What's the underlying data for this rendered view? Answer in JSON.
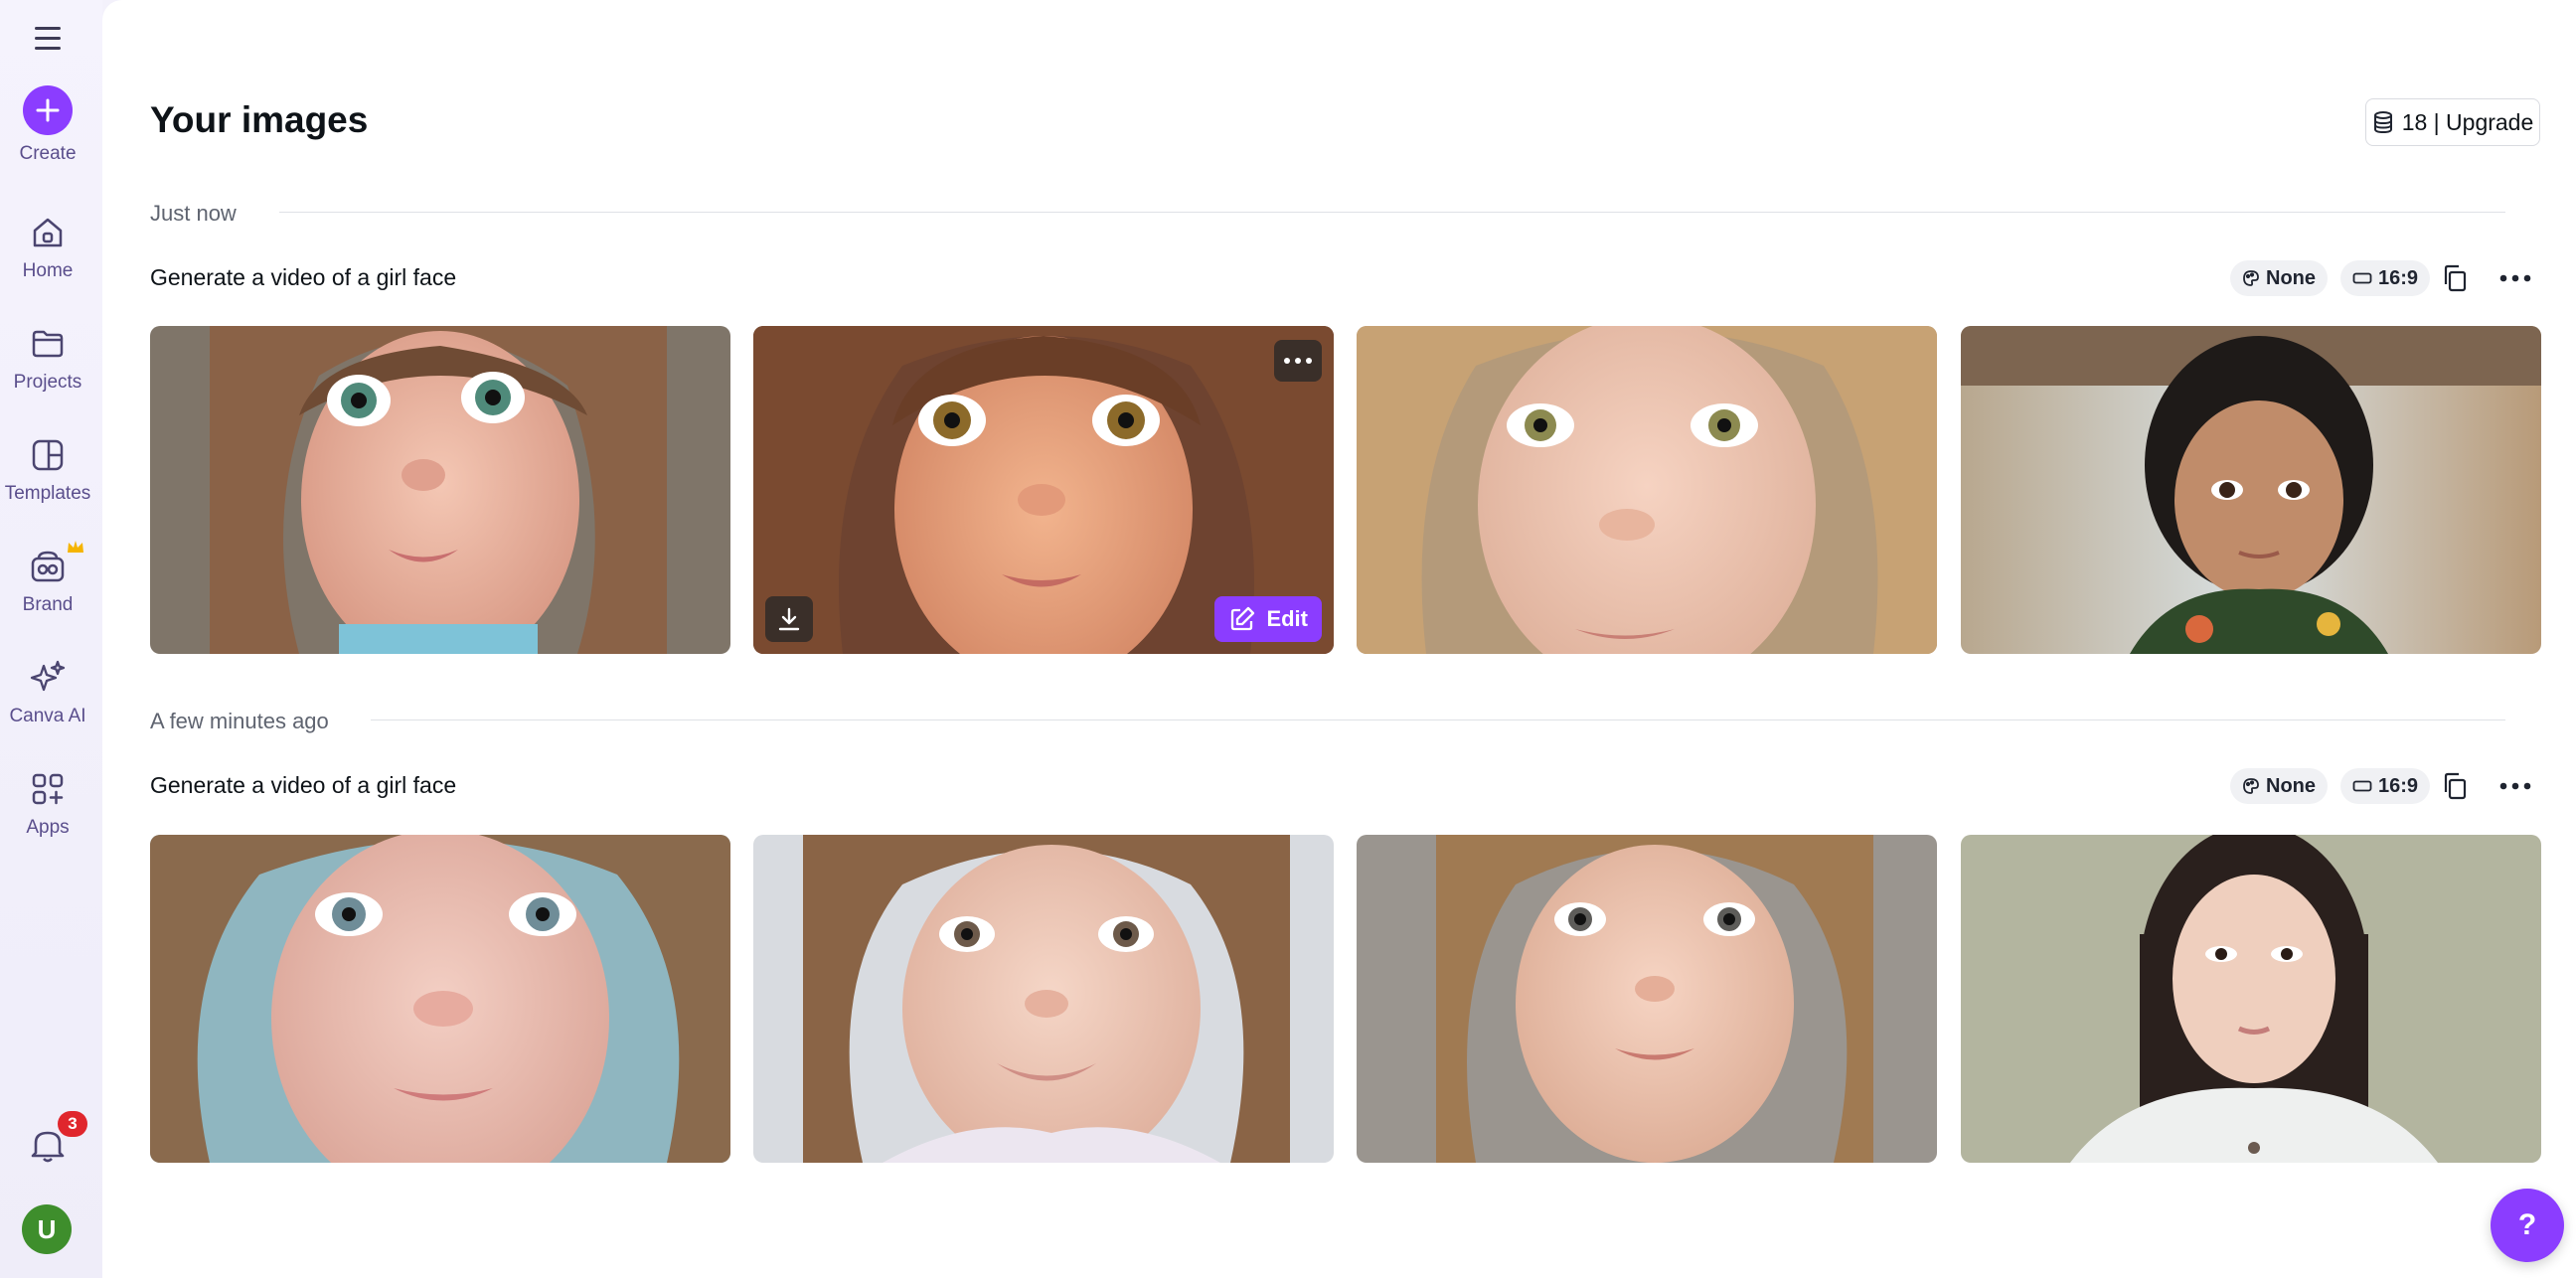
{
  "sidebar": {
    "menu_icon": "hamburger-menu-icon",
    "items": [
      {
        "label": "Create",
        "icon": "plus-icon"
      },
      {
        "label": "Home",
        "icon": "home-icon"
      },
      {
        "label": "Projects",
        "icon": "folder-icon"
      },
      {
        "label": "Templates",
        "icon": "templates-icon"
      },
      {
        "label": "Brand",
        "icon": "brand-icon"
      },
      {
        "label": "Canva AI",
        "icon": "sparkle-icon"
      },
      {
        "label": "Apps",
        "icon": "apps-grid-icon"
      }
    ],
    "notifications_count": "3",
    "avatar_initial": "U"
  },
  "header": {
    "title": "Your images",
    "credits_label": "18 | Upgrade"
  },
  "groups": [
    {
      "time": "Just now",
      "prompt": "Generate a video of a girl face",
      "style_chip": "None",
      "ratio_chip": "16:9",
      "images": [
        "girl-portrait-1",
        "girl-portrait-2",
        "girl-portrait-3",
        "girl-portrait-4"
      ],
      "hover_edit_label": "Edit"
    },
    {
      "time": "A few minutes ago",
      "prompt": "Generate a video of a girl face",
      "style_chip": "None",
      "ratio_chip": "16:9",
      "images": [
        "girl-portrait-5",
        "girl-portrait-6",
        "girl-portrait-7",
        "girl-portrait-8"
      ]
    }
  ],
  "help_label": "?",
  "colors": {
    "accent": "#8b3dff",
    "sidebar_bg": "#f3f1fb",
    "badge": "#e0262d",
    "avatar": "#3e8e2c"
  }
}
